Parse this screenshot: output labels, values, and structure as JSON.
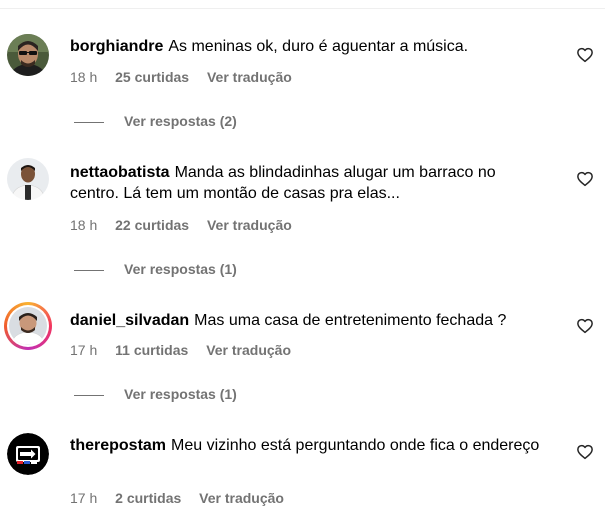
{
  "comments": [
    {
      "username": "borghiandre",
      "text": "As meninas ok, duro é aguentar a música.",
      "time": "18 h",
      "likes": "25 curtidas",
      "translate": "Ver tradução",
      "replies": "Ver respostas (2)",
      "like_icon": "heart-outline-icon"
    },
    {
      "username": "nettaobatista",
      "text": "Manda as blindadinhas alugar um barraco no centro. Lá tem um montão de casas pra elas...",
      "time": "18 h",
      "likes": "22 curtidas",
      "translate": "Ver tradução",
      "replies": "Ver respostas (1)",
      "like_icon": "heart-outline-icon"
    },
    {
      "username": "daniel_silvadan",
      "text": "Mas uma casa de entretenimento fechada ?",
      "time": "17 h",
      "likes": "11 curtidas",
      "translate": "Ver tradução",
      "replies": "Ver respostas (1)",
      "like_icon": "heart-outline-icon"
    },
    {
      "username": "therepostam",
      "text": "Meu vizinho está perguntando onde fica o endereço",
      "time": "17 h",
      "likes": "2 curtidas",
      "translate": "Ver tradução",
      "like_icon": "heart-outline-icon"
    }
  ],
  "colors": {
    "meta_text": "#737373",
    "story_ring": [
      "#f9b332",
      "#f2355f",
      "#c22fb3"
    ]
  }
}
